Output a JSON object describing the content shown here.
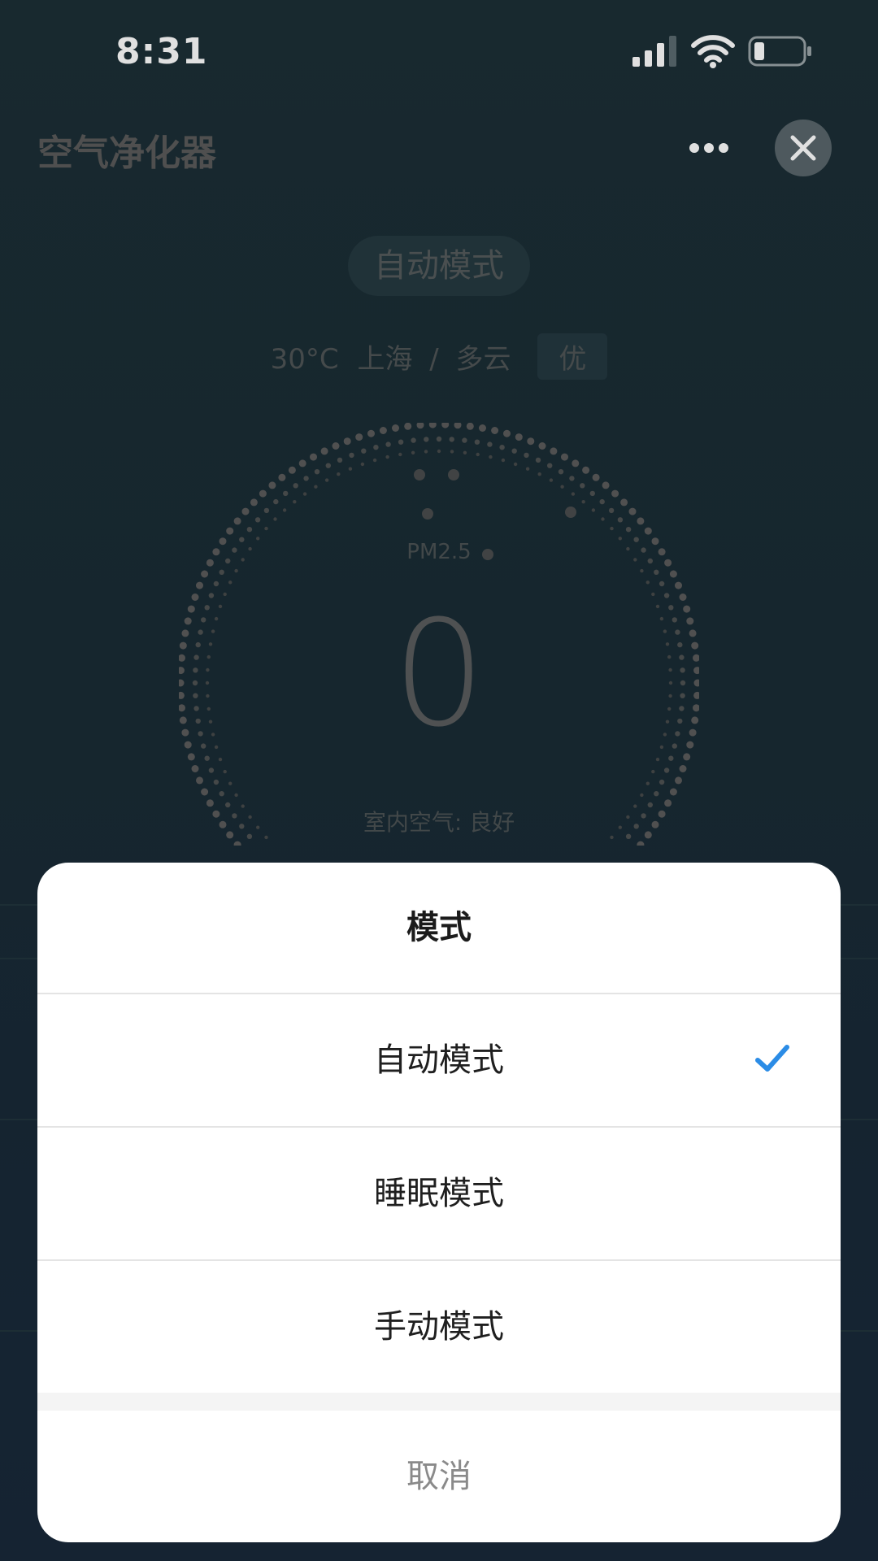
{
  "status_bar": {
    "time": "8:31"
  },
  "app": {
    "title": "空气净化器",
    "current_mode": "自动模式",
    "weather": {
      "temp": "30°C",
      "city": "上海",
      "separator": "/",
      "condition": "多云",
      "aqi": "优"
    },
    "pm_label": "PM2.5",
    "pm_value": "0",
    "air_status": "室内空气: 良好"
  },
  "sheet": {
    "title": "模式",
    "options": [
      {
        "label": "自动模式",
        "selected": true
      },
      {
        "label": "睡眠模式",
        "selected": false
      },
      {
        "label": "手动模式",
        "selected": false
      }
    ],
    "cancel_label": "取消"
  },
  "colors": {
    "accent": "#2b8ce6",
    "sheet_bg": "#ffffff",
    "bg_top": "#1c2f36",
    "bg_bottom": "#18283a"
  },
  "icons": {
    "more": "more-dots-icon",
    "close": "close-icon",
    "check": "checkmark-icon",
    "signal": "signal-icon",
    "wifi": "wifi-icon",
    "battery": "battery-icon"
  }
}
